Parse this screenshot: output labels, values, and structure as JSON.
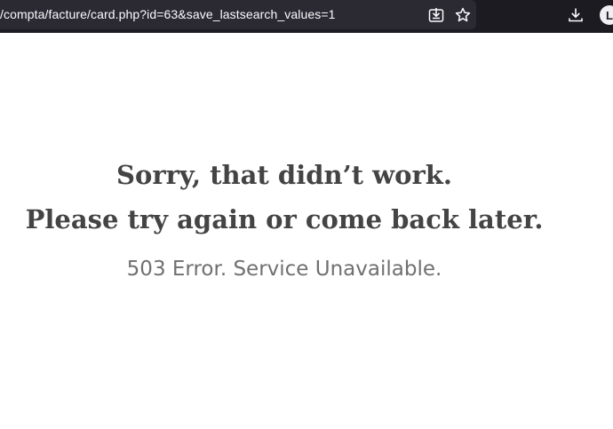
{
  "browser": {
    "url": "/compta/facture/card.php?id=63&save_lastsearch_values=1",
    "icons": {
      "save_page": "save-to-disk-icon",
      "bookmark": "star-icon",
      "downloads": "download-icon"
    },
    "account_initial": "L",
    "colors": {
      "toolbar": "#1c1b22",
      "url_field": "#2b2a33"
    }
  },
  "error_page": {
    "title_line1": "Sorry, that didn’t work.",
    "title_line2": "Please try again or come back later.",
    "detail": "503 Error. Service Unavailable.",
    "colors": {
      "title": "#444444",
      "detail": "#707070",
      "background": "#ffffff"
    }
  }
}
